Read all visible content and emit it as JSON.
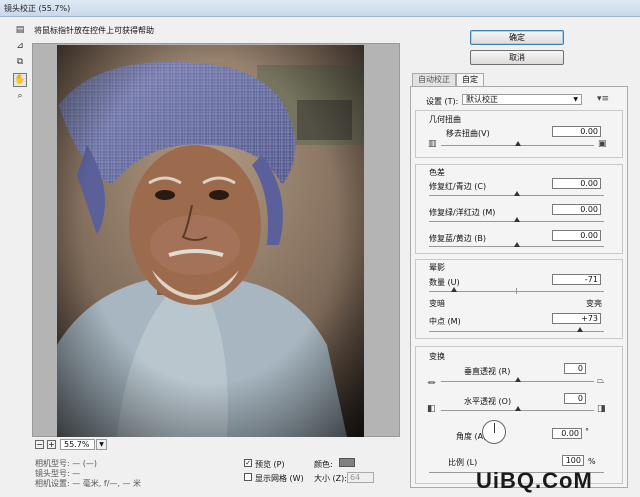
{
  "window": {
    "title": "镜头校正 (55.7%)"
  },
  "hint": "将鼠标指针放在控件上可获得帮助",
  "buttons": {
    "ok": "确定",
    "cancel": "取消"
  },
  "tabs": {
    "auto": "自动校正",
    "custom": "自定"
  },
  "settings": {
    "label": "设置 (T):",
    "value": "默认校正"
  },
  "geometric": {
    "title": "几何扭曲",
    "remove_distortion_label": "移去扭曲(V)",
    "remove_distortion_value": "0.00"
  },
  "chromatic": {
    "title": "色差",
    "rows": [
      {
        "label": "修复红/青边 (C)",
        "value": "0.00"
      },
      {
        "label": "修复绿/洋红边 (M)",
        "value": "0.00"
      },
      {
        "label": "修复蓝/黄边 (B)",
        "value": "0.00"
      }
    ]
  },
  "vignette": {
    "title": "晕影",
    "amount_label": "数量 (U)",
    "amount_value": "-71",
    "darken": "变暗",
    "lighten": "变亮",
    "midpoint_label": "中点 (M)",
    "midpoint_value": "+73"
  },
  "transform": {
    "title": "变换",
    "vertical_label": "垂直透视 (R)",
    "vertical_value": "0",
    "horizontal_label": "水平透视 (O)",
    "horizontal_value": "0",
    "angle_label": "角度 (A):",
    "angle_value": "0.00",
    "angle_unit": "°",
    "scale_label": "比例 (L)",
    "scale_value": "100",
    "scale_unit": "%"
  },
  "zoom": {
    "value": "55.7%"
  },
  "camera_info": {
    "camera_model_label": "相机型号:",
    "camera_model_value": "— (—)",
    "lens_model_label": "镜头型号:",
    "lens_model_value": "—",
    "camera_settings_label": "相机设置:",
    "camera_settings_value": "— 毫米, f/—, — 米"
  },
  "preview": {
    "label": "预览 (P)",
    "checked": true
  },
  "show_grid": {
    "label": "显示网格 (W)",
    "checked": false
  },
  "color": {
    "label": "颜色:",
    "swatch": "#808080"
  },
  "size": {
    "label": "大小 (Z):",
    "value": "64"
  },
  "watermark": "UiBQ.CoM",
  "slider_levels": {
    "remove_distortion": 0.5,
    "red_cyan": 0.5,
    "green_magenta": 0.5,
    "blue_yellow": 0.5,
    "vignette_amount": 0.14,
    "vignette_midpoint": 0.86,
    "vertical_perspective": 0.5,
    "horizontal_perspective": 0.5
  }
}
